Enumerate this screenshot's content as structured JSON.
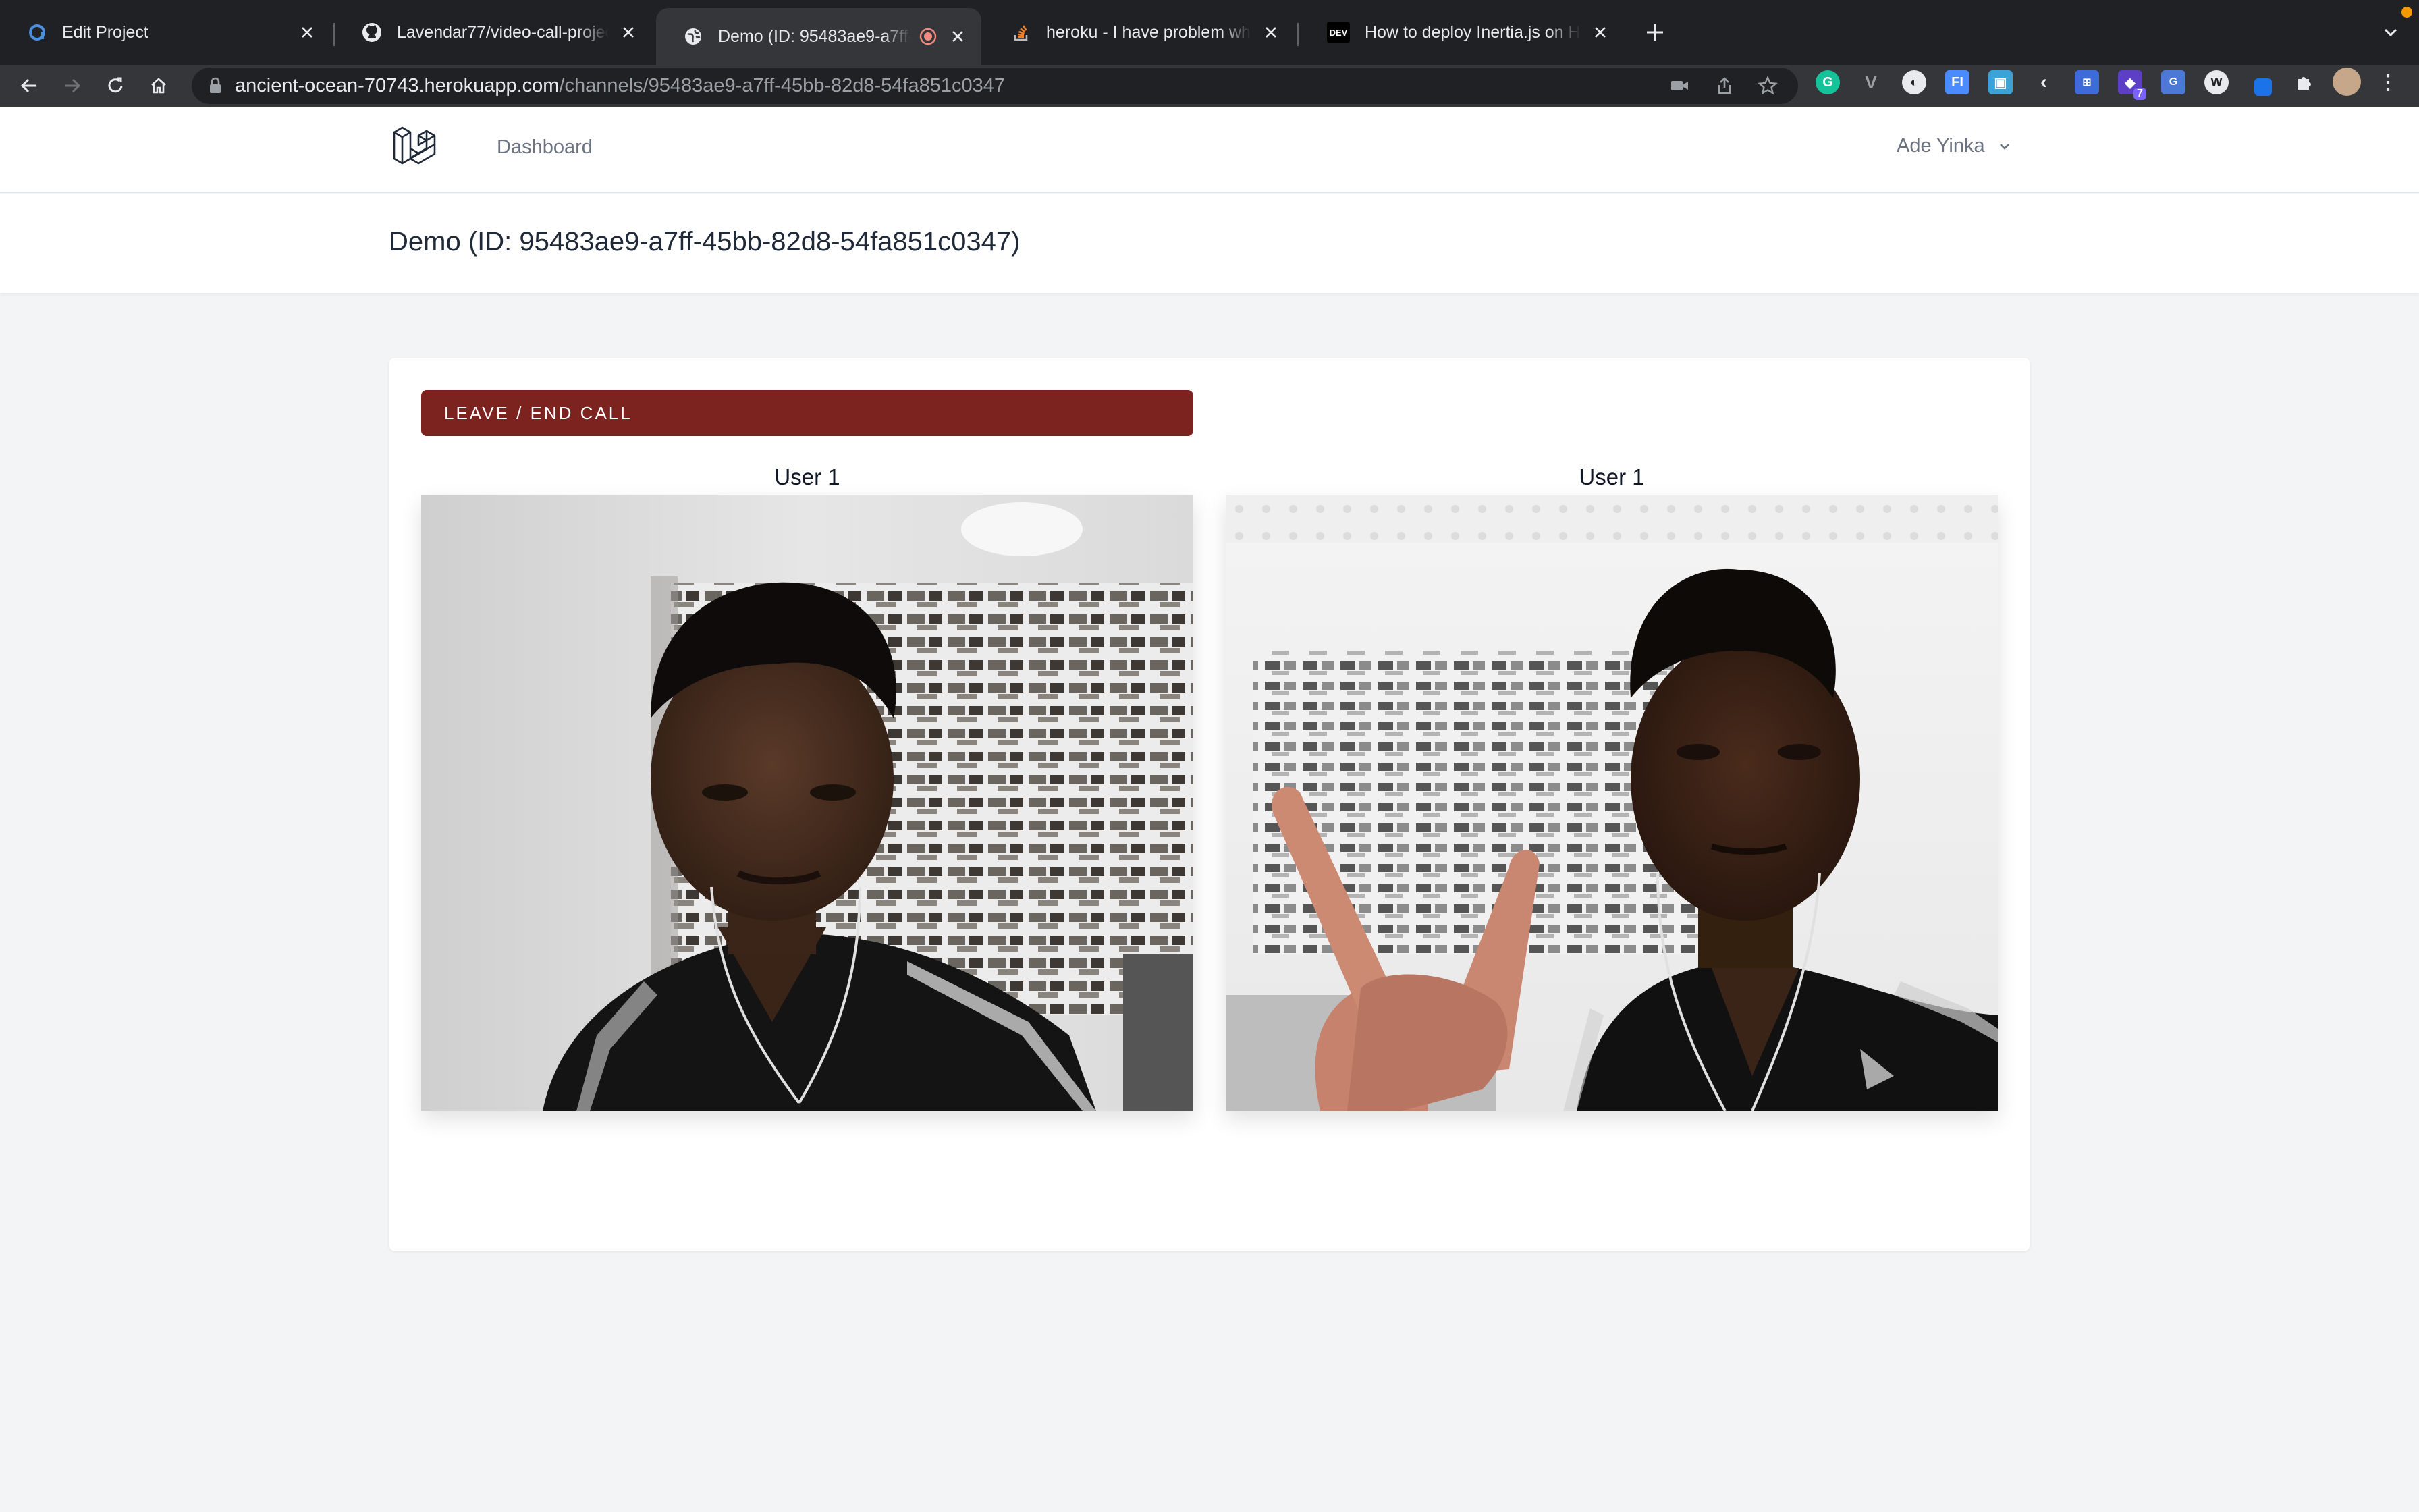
{
  "browser": {
    "tabs": [
      {
        "title": "Edit Project",
        "favicon": "app-icon"
      },
      {
        "title": "Lavendar77/video-call-project",
        "favicon": "github-icon"
      },
      {
        "title": "Demo (ID: 95483ae9-a7ff-45bb-82d8-54fa851c0347)",
        "favicon": "globe-icon",
        "active": true,
        "recording": true
      },
      {
        "title": "heroku - I have problem when deploying",
        "favicon": "stackoverflow-icon"
      },
      {
        "title": "How to deploy Inertia.js on Heroku",
        "favicon": "dev-icon"
      }
    ],
    "address": {
      "host": "ancient-ocean-70743.herokuapp.com",
      "path": "/channels/95483ae9-a7ff-45bb-82d8-54fa851c0347"
    },
    "extension_badge": "7",
    "dev_favicon_text": "DEV"
  },
  "app": {
    "nav": {
      "dashboard_label": "Dashboard",
      "user_name": "Ade Yinka"
    },
    "page_title": "Demo (ID: 95483ae9-a7ff-45bb-82d8-54fa851c0347)",
    "call": {
      "leave_label": "LEAVE / END CALL",
      "participants": [
        {
          "label": "User 1"
        },
        {
          "label": "User 1"
        }
      ]
    }
  },
  "colors": {
    "leave_button": "#7c2320",
    "page_background": "#f3f4f6",
    "chrome_dark": "#202124",
    "chrome_toolbar": "#35363a"
  }
}
